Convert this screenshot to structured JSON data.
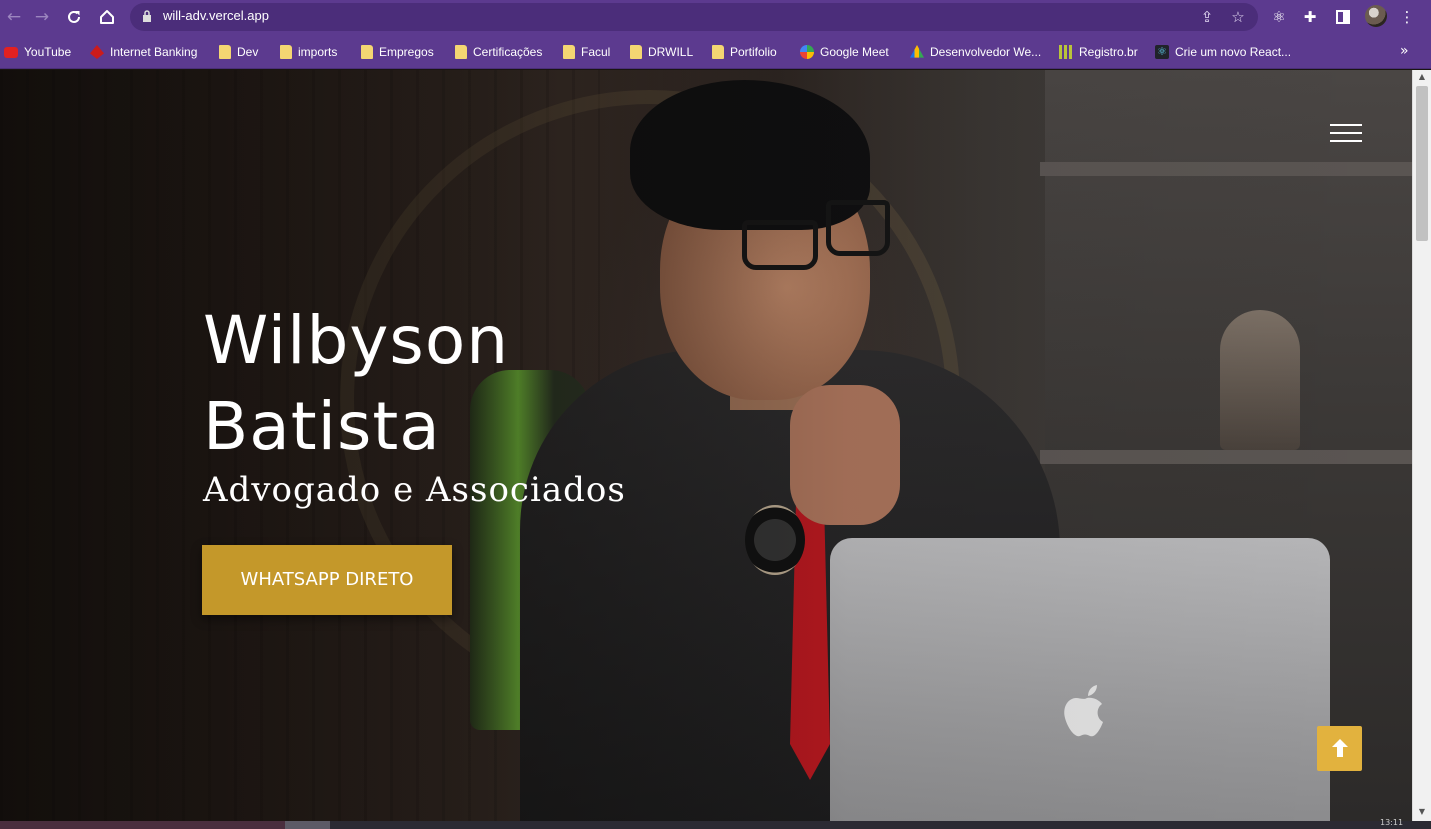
{
  "browser": {
    "url": "will-adv.vercel.app",
    "accent_color": "#5c3a8f"
  },
  "bookmarks": [
    {
      "label": "YouTube",
      "icon": "youtube-icon"
    },
    {
      "label": "Internet Banking",
      "icon": "bank-icon"
    },
    {
      "label": "Dev",
      "icon": "folder-icon"
    },
    {
      "label": "imports",
      "icon": "folder-icon"
    },
    {
      "label": "Empregos",
      "icon": "folder-icon"
    },
    {
      "label": "Certificações",
      "icon": "folder-icon"
    },
    {
      "label": "Facul",
      "icon": "folder-icon"
    },
    {
      "label": "DRWILL",
      "icon": "folder-icon"
    },
    {
      "label": "Portifolio",
      "icon": "folder-icon"
    },
    {
      "label": "Google Meet",
      "icon": "meet-icon"
    },
    {
      "label": "Desenvolvedor We...",
      "icon": "drive-icon"
    },
    {
      "label": "Registro.br",
      "icon": "registro-icon"
    },
    {
      "label": "Crie um novo React...",
      "icon": "react-icon"
    }
  ],
  "hero": {
    "title_line1": "Wilbyson",
    "title_line2": "Batista",
    "subtitle": "Advogado e Associados",
    "cta_label": "WHATSAPP DIRETO",
    "cta_color": "#c4982a",
    "to_top_color": "#e2b23e"
  },
  "taskbar": {
    "clock": "13:11"
  }
}
